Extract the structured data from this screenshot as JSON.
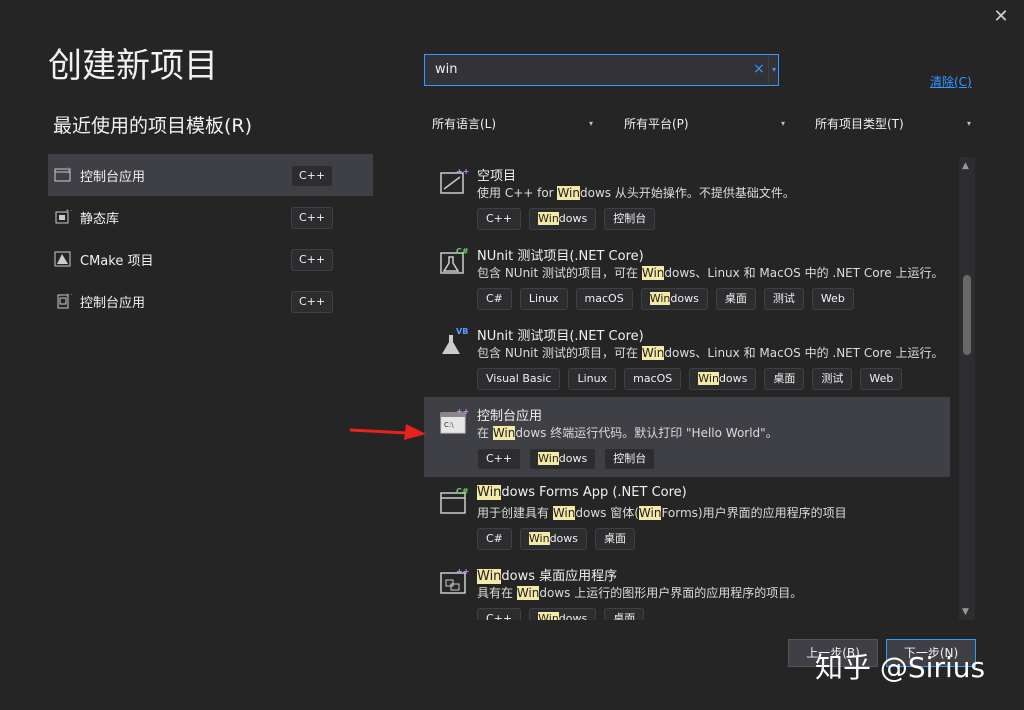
{
  "title": "创建新项目",
  "recent": {
    "heading": "最近使用的项目模板(R)",
    "items": [
      {
        "label": "控制台应用",
        "lang": "C++",
        "icon": "console-app-icon"
      },
      {
        "label": "静态库",
        "lang": "C++",
        "icon": "static-library-icon"
      },
      {
        "label": "CMake 项目",
        "lang": "C++",
        "icon": "cmake-icon"
      },
      {
        "label": "控制台应用",
        "lang": "C++",
        "icon": "console-app-icon"
      }
    ]
  },
  "search": {
    "value": "win",
    "clear_glyph": "×",
    "drop_glyph": "▾"
  },
  "clear_all": "清除(C)",
  "filters": [
    {
      "label": "所有语言(L)",
      "arrow": "▾"
    },
    {
      "label": "所有平台(P)",
      "arrow": "▾"
    },
    {
      "label": "所有项目类型(T)",
      "arrow": "▾"
    }
  ],
  "templates": [
    {
      "title": [
        "空项目"
      ],
      "desc": [
        "使用 C++ for ",
        "Win",
        "dows 从头开始操作。不提供基础文件。"
      ],
      "tags": [
        [
          "C++"
        ],
        [
          "",
          "Win",
          "dows"
        ],
        [
          "控制台"
        ]
      ],
      "badge": "++",
      "badge_color": "#c984f5"
    },
    {
      "title": [
        "NUnit 测试项目(.NET Core)"
      ],
      "desc": [
        "包含 NUnit 测试的项目，可在 ",
        "Win",
        "dows、Linux 和 MacOS 中的 .NET Core 上运行。"
      ],
      "tags": [
        [
          "C#"
        ],
        [
          "Linux"
        ],
        [
          "macOS"
        ],
        [
          "",
          "Win",
          "dows"
        ],
        [
          "桌面"
        ],
        [
          "测试"
        ],
        [
          "Web"
        ]
      ],
      "badge": "C#",
      "badge_color": "#6bd06b"
    },
    {
      "title": [
        "NUnit 测试项目(.NET Core)"
      ],
      "desc": [
        "包含 NUnit 测试的项目，可在 ",
        "Win",
        "dows、Linux 和 MacOS 中的 .NET Core 上运行。"
      ],
      "tags": [
        [
          "Visual Basic"
        ],
        [
          "Linux"
        ],
        [
          "macOS"
        ],
        [
          "",
          "Win",
          "dows"
        ],
        [
          "桌面"
        ],
        [
          "测试"
        ],
        [
          "Web"
        ]
      ],
      "badge": "VB",
      "badge_color": "#5aa0ff"
    },
    {
      "title": [
        "控制台应用"
      ],
      "desc": [
        "在 ",
        "Win",
        "dows 终端运行代码。默认打印 \"Hello World\"。"
      ],
      "tags": [
        [
          "C++"
        ],
        [
          "",
          "Win",
          "dows"
        ],
        [
          "控制台"
        ]
      ],
      "badge": "++",
      "badge_color": "#c984f5"
    },
    {
      "title": [
        "",
        "Win",
        "dows Forms App (.NET Core)"
      ],
      "desc": [
        "用于创建具有 ",
        "Win",
        "dows 窗体(",
        "Win",
        "Forms)用户界面的应用程序的项目"
      ],
      "tags": [
        [
          "C#"
        ],
        [
          "",
          "Win",
          "dows"
        ],
        [
          "桌面"
        ]
      ],
      "badge": "C#",
      "badge_color": "#6bd06b"
    },
    {
      "title": [
        "",
        "Win",
        "dows 桌面应用程序"
      ],
      "desc": [
        "具有在 ",
        "Win",
        "dows 上运行的图形用户界面的应用程序的项目。"
      ],
      "tags": [
        [
          "C++"
        ],
        [
          "",
          "Win",
          "dows"
        ],
        [
          "桌面"
        ]
      ],
      "badge": "++",
      "badge_color": "#c984f5"
    }
  ],
  "buttons": {
    "back": "上一步(B)",
    "next": "下一步(N)"
  },
  "watermark": "知乎 @Sirius",
  "close_glyph": "✕",
  "scroll": {
    "up": "▲",
    "down": "▼"
  },
  "selected_template_index": 3
}
